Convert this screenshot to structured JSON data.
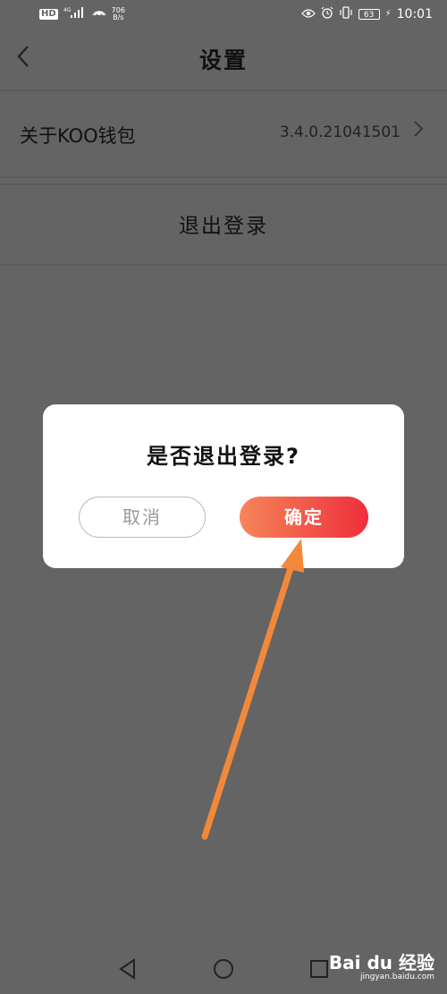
{
  "status_bar": {
    "hd": "HD",
    "network": "4G",
    "speed_value": "706",
    "speed_unit": "B/s",
    "battery": "63",
    "time": "10:01"
  },
  "header": {
    "title": "设置",
    "back_icon": "chevron-left-icon"
  },
  "settings": {
    "about_label": "关于KOO钱包",
    "about_version": "3.4.0.21041501",
    "logout_label": "退出登录"
  },
  "dialog": {
    "title": "是否退出登录?",
    "cancel_label": "取消",
    "confirm_label": "确定",
    "confirm_gradient": [
      "#f6855a",
      "#ef2f3b"
    ]
  },
  "annotation": {
    "arrow_color": "#f2893a"
  },
  "watermark": {
    "logo": "Bai du 经验",
    "site": "jingyan.baidu.com"
  }
}
